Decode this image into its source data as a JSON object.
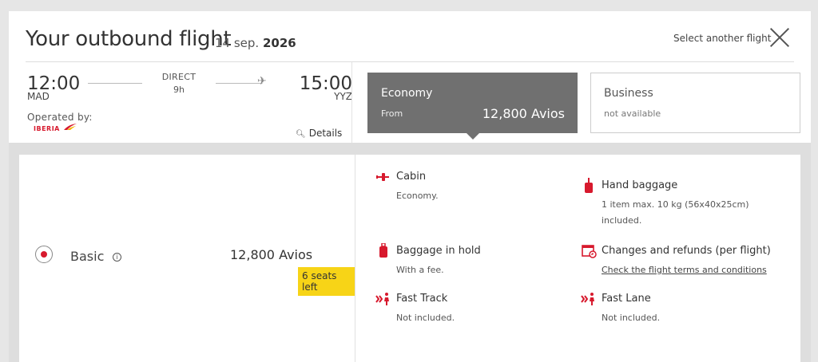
{
  "header": {
    "title": "Your outbound flight",
    "date_day": "14 sep.",
    "date_year": "2026",
    "select_another": "Select another flight",
    "close_icon": "close-icon"
  },
  "flight": {
    "departure_time": "12:00",
    "departure_code": "MAD",
    "arrival_time": "15:00",
    "arrival_code": "YYZ",
    "stops": "DIRECT",
    "duration": "9h",
    "operated_by_label": "Operated by:",
    "operator_logo": "IBERIA",
    "details_label": "Details"
  },
  "cabins": {
    "economy": {
      "name": "Economy",
      "from_label": "From",
      "price": "12,800 Avios"
    },
    "business": {
      "name": "Business",
      "status": "not available"
    }
  },
  "fare": {
    "name": "Basic",
    "price": "12,800 Avios",
    "seats_left": "6 seats left",
    "features": [
      {
        "icon": "cabin-icon",
        "title": "Cabin",
        "desc": [
          "Economy."
        ]
      },
      {
        "icon": "hand-baggage-icon",
        "title": "Hand baggage",
        "desc": [
          "1 item max. 10 kg (56x40x25cm)",
          "included."
        ]
      },
      {
        "icon": "baggage-hold-icon",
        "title": "Baggage in hold",
        "desc": [
          "With a fee."
        ]
      },
      {
        "icon": "calendar-icon",
        "title": "Changes and refunds (per flight)",
        "desc": [
          "Check the flight terms and conditions"
        ]
      },
      {
        "icon": "fast-track-icon",
        "title": "Fast Track",
        "desc": [
          "Not included."
        ]
      },
      {
        "icon": "fast-lane-icon",
        "title": "Fast Lane",
        "desc": [
          "Not included."
        ]
      }
    ]
  },
  "colors": {
    "brand_red": "#d7192d",
    "economy_bg": "#707070",
    "seats_badge": "#f7d417"
  }
}
